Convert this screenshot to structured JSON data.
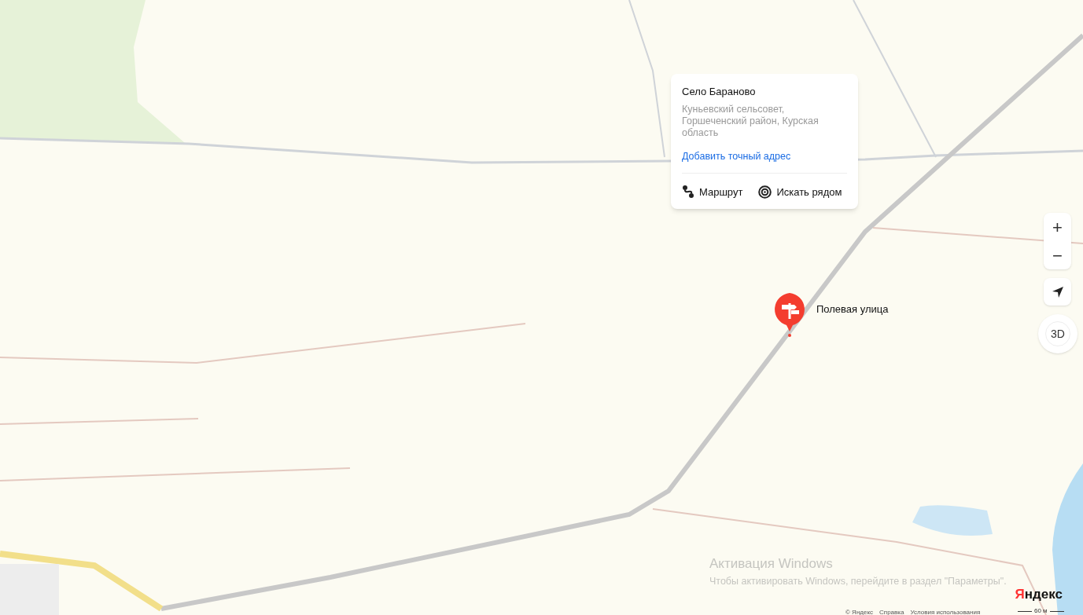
{
  "popup": {
    "title": "Село Бараново",
    "subtitle": "Куньевский сельсовет, Горшеченский район, Курская область",
    "link": "Добавить точный адрес",
    "actions": [
      {
        "kind": "route",
        "label": "Маршрут"
      },
      {
        "kind": "nearby",
        "label": "Искать рядом"
      }
    ]
  },
  "placemark": {
    "label": "Полевая улица"
  },
  "controls": {
    "zoom_in": "+",
    "zoom_out": "−",
    "mode_3d": "3D"
  },
  "windows_activation": {
    "title": "Активация Windows",
    "text": "Чтобы активировать Windows, перейдите в раздел \"Параметры\"."
  },
  "logo": "Яндекс",
  "footer_links": [
    "© Яндекс",
    "Справка",
    "Условия использования"
  ],
  "scale": "60 м"
}
